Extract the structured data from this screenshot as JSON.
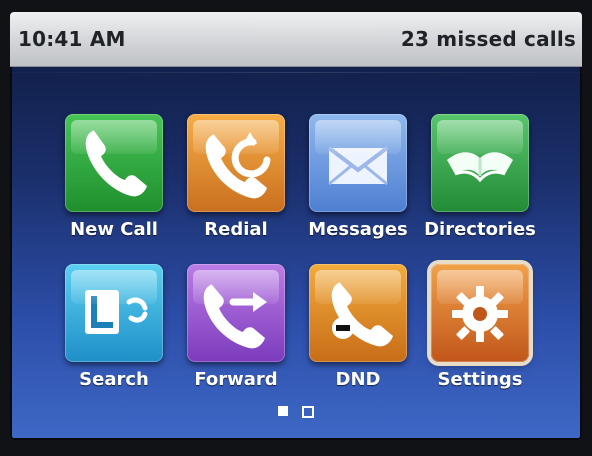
{
  "status_bar": {
    "time": "10:41 AM",
    "notification": "23 missed calls"
  },
  "tiles": [
    {
      "label": "New Call",
      "icon": "phone-icon",
      "color": "#2eaa3f"
    },
    {
      "label": "Redial",
      "icon": "redial-icon",
      "color": "#e58b2d"
    },
    {
      "label": "Messages",
      "icon": "envelope-icon",
      "color": "#6f9ce0"
    },
    {
      "label": "Directories",
      "icon": "open-book-icon",
      "color": "#33a74b"
    },
    {
      "label": "Search",
      "icon": "lync-search-icon",
      "color": "#2aa9de"
    },
    {
      "label": "Forward",
      "icon": "call-forward-icon",
      "color": "#9a57d2"
    },
    {
      "label": "DND",
      "icon": "do-not-disturb-icon",
      "color": "#e1861f"
    },
    {
      "label": "Settings",
      "icon": "gear-icon",
      "color": "#d46f28"
    }
  ],
  "pagination": {
    "total": 2,
    "current": 1
  }
}
